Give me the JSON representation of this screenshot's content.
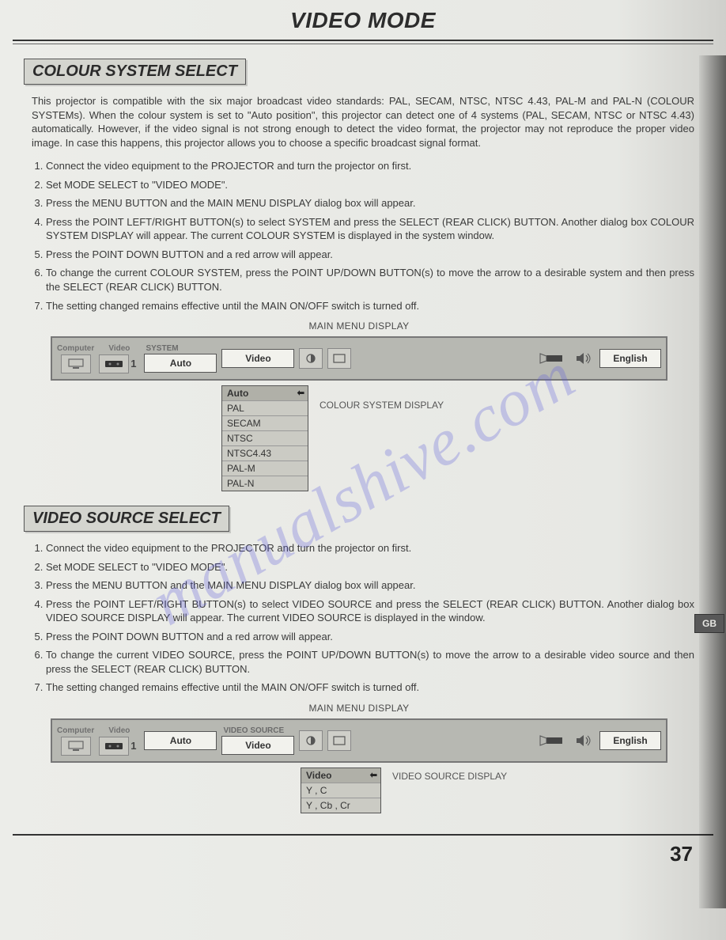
{
  "page_title": "VIDEO MODE",
  "watermark": "manualshive.com",
  "side_tab": "GB",
  "page_number": "37",
  "section1": {
    "heading": "COLOUR SYSTEM SELECT",
    "intro": "This projector is compatible with the six major broadcast video standards: PAL, SECAM, NTSC, NTSC 4.43, PAL-M and PAL-N (COLOUR SYSTEMs). When the colour system is set to \"Auto position\", this projector can detect one of 4 systems (PAL, SECAM, NTSC or NTSC 4.43) automatically. However, if the video signal is not strong enough to detect the video format, the projector may not reproduce the proper video image. In case this happens, this projector allows you to choose a specific broadcast signal format.",
    "steps": [
      "Connect the video equipment to the PROJECTOR and turn the projector on first.",
      "Set MODE SELECT to \"VIDEO MODE\".",
      "Press the MENU BUTTON and the MAIN MENU DISPLAY dialog box will appear.",
      "Press the POINT LEFT/RIGHT BUTTON(s) to select SYSTEM and press the SELECT (REAR CLICK) BUTTON. Another dialog box COLOUR SYSTEM DISPLAY will appear. The current COLOUR SYSTEM is displayed in the system window.",
      "Press the POINT DOWN BUTTON and a red arrow will appear.",
      "To change the current COLOUR SYSTEM, press the POINT UP/DOWN BUTTON(s) to move the arrow to a desirable system and then press the SELECT (REAR CLICK) BUTTON.",
      "The setting changed remains effective until the MAIN ON/OFF switch is turned off."
    ],
    "menu_caption": "MAIN MENU DISPLAY",
    "dropdown_caption": "COLOUR SYSTEM DISPLAY",
    "dropdown": [
      "Auto",
      "PAL",
      "SECAM",
      "NTSC",
      "NTSC4.43",
      "PAL-M",
      "PAL-N"
    ]
  },
  "section2": {
    "heading": "VIDEO SOURCE SELECT",
    "steps": [
      "Connect the video equipment to the PROJECTOR and turn the projector on first.",
      "Set MODE SELECT to \"VIDEO MODE\".",
      "Press the MENU BUTTON and the MAIN MENU DISPLAY dialog box will appear.",
      "Press the POINT LEFT/RIGHT BUTTON(s) to select VIDEO SOURCE and press the SELECT (REAR CLICK) BUTTON. Another dialog box VIDEO SOURCE DISPLAY will appear. The current VIDEO SOURCE is displayed in the window.",
      "Press the POINT DOWN BUTTON and a red arrow will appear.",
      "To change the current VIDEO SOURCE, press the POINT UP/DOWN BUTTON(s) to move the arrow to a desirable video source and then press the SELECT (REAR CLICK) BUTTON.",
      "The setting changed remains effective until the MAIN ON/OFF switch is turned off."
    ],
    "menu_caption": "MAIN MENU DISPLAY",
    "dropdown_caption": "VIDEO SOURCE DISPLAY",
    "dropdown": [
      "Video",
      "Y , C",
      "Y , Cb , Cr"
    ]
  },
  "osd": {
    "computer_label": "Computer",
    "video_label": "Video",
    "system_label": "SYSTEM",
    "video_source_label": "VIDEO SOURCE",
    "input_number": "1",
    "auto": "Auto",
    "video": "Video",
    "english": "English"
  }
}
